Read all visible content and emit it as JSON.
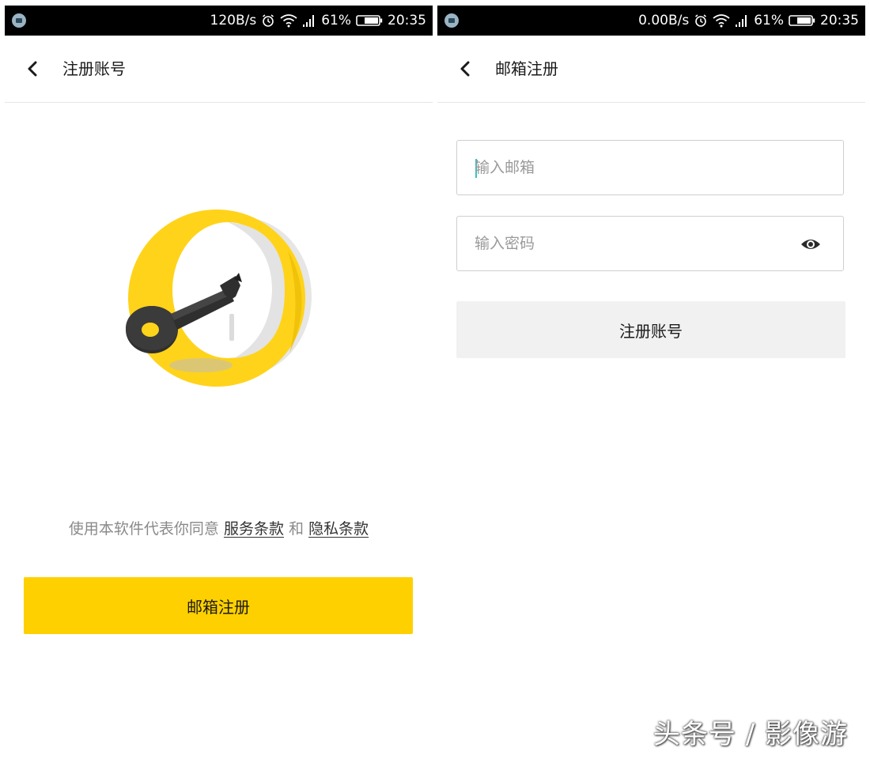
{
  "screens": [
    {
      "status_bar": {
        "network_speed": "120B/s",
        "battery_percent": "61%",
        "time": "20:35"
      },
      "header": {
        "title": "注册账号"
      },
      "terms": {
        "prefix": "使用本软件代表你同意",
        "service_link": "服务条款",
        "conjunction": "和",
        "privacy_link": "隐私条款"
      },
      "email_register_button": "邮箱注册"
    },
    {
      "status_bar": {
        "network_speed": "0.00B/s",
        "battery_percent": "61%",
        "time": "20:35"
      },
      "header": {
        "title": "邮箱注册"
      },
      "form": {
        "email_placeholder": "输入邮箱",
        "password_placeholder": "输入密码",
        "submit_label": "注册账号"
      }
    }
  ],
  "watermark": "头条号 / 影像游",
  "colors": {
    "accent_yellow": "#ffd000",
    "status_bar": "#000000",
    "disabled_button": "#f1f1f1"
  },
  "icons": [
    "back-arrow-icon",
    "alarm-icon",
    "wifi-icon",
    "signal-icon",
    "battery-icon",
    "eye-icon",
    "key-illustration"
  ]
}
